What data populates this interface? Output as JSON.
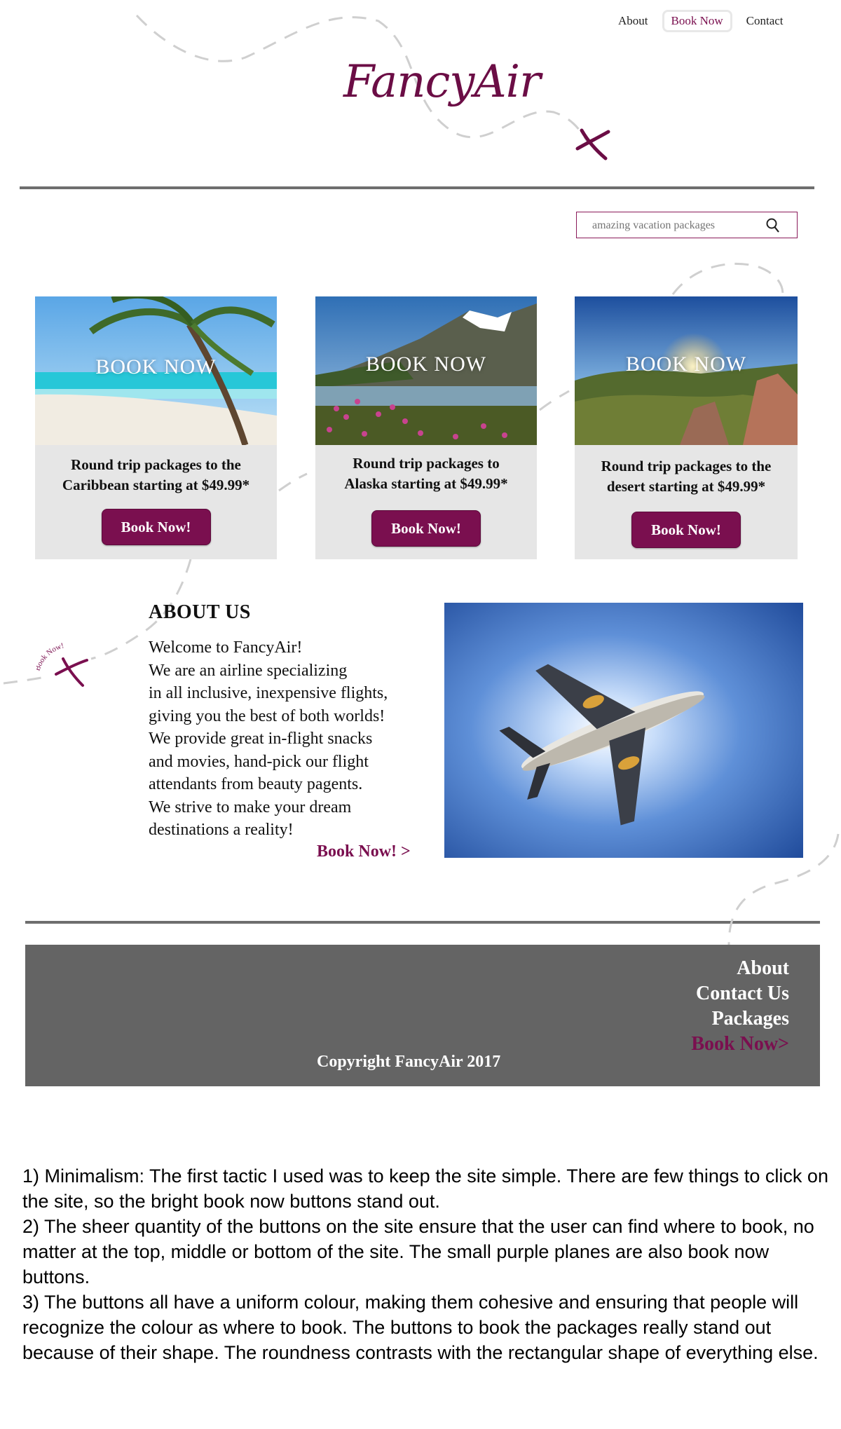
{
  "nav": {
    "about": "About",
    "book_now": "Book Now",
    "contact": "Contact"
  },
  "logo": {
    "text": "FancyAir"
  },
  "search": {
    "placeholder": "amazing vacation packages"
  },
  "packages": [
    {
      "overlay": "BOOK NOW",
      "line1": "Round trip packages to the",
      "line2": "Caribbean starting at $49.99*",
      "button": "Book Now!"
    },
    {
      "overlay": "BOOK NOW",
      "line1": "Round trip packages to",
      "line2": "Alaska starting at $49.99*",
      "button": "Book Now!"
    },
    {
      "overlay": "BOOK NOW",
      "line1": "Round trip packages to the",
      "line2": "desert starting at $49.99*",
      "button": "Book Now!"
    }
  ],
  "about": {
    "title": "ABOUT US",
    "lines": [
      "Welcome to FancyAir!",
      "We are an airline specializing",
      "in all inclusive, inexpensive flights,",
      "giving you the best of  both worlds!",
      "We provide great in-flight snacks",
      "and movies, hand-pick our flight",
      "attendants from beauty pagents.",
      "We strive to make your dream",
      "destinations a reality!"
    ],
    "link": "Book Now! >"
  },
  "small_plane_label": "Book Now!",
  "footer": {
    "links": {
      "about": "About",
      "contact": "Contact Us",
      "packages": "Packages",
      "book": "Book Now>"
    },
    "copyright": "Copyright FancyAir 2017"
  },
  "notes": [
    "1) Minimalism: The first tactic I used was to keep the site simple. There are few things to click on the site, so the bright book now buttons stand out.",
    "2) The sheer quantity of the buttons on the site ensure that the user can find where to book, no matter at the top, middle or bottom of the site. The small purple planes are also book now buttons.",
    "3) The buttons all have a uniform colour, making them cohesive and ensuring that people will recognize the colour as where to book. The buttons to book the packages really stand out because of their shape. The roundness contrasts with the rectangular shape of everything else."
  ],
  "colors": {
    "accent": "#7a0f4f",
    "footer_bg": "#646464",
    "card_bg": "#e6e6e6",
    "rule": "#6e6e6e"
  },
  "icons": [
    "search-icon",
    "plane-icon"
  ]
}
